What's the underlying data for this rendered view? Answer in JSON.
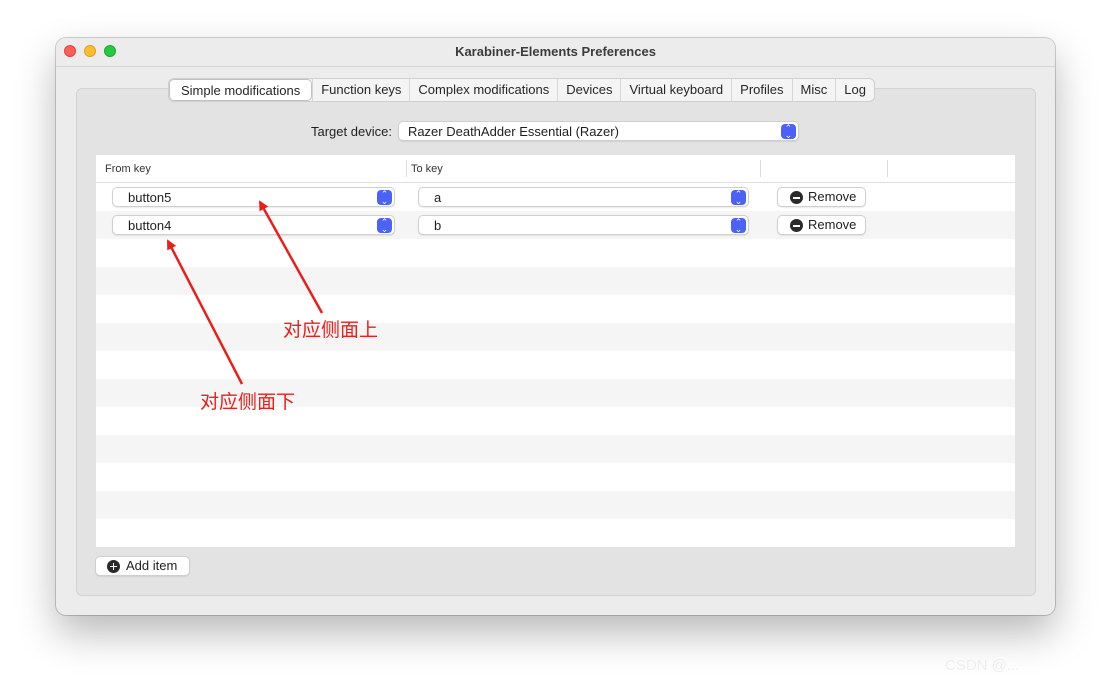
{
  "window": {
    "title": "Karabiner-Elements Preferences"
  },
  "tabs": [
    {
      "label": "Simple modifications",
      "active": true
    },
    {
      "label": "Function keys"
    },
    {
      "label": "Complex modifications"
    },
    {
      "label": "Devices"
    },
    {
      "label": "Virtual keyboard"
    },
    {
      "label": "Profiles"
    },
    {
      "label": "Misc"
    },
    {
      "label": "Log"
    }
  ],
  "target": {
    "label": "Target device:",
    "value": "Razer DeathAdder Essential (Razer)"
  },
  "table": {
    "headers": {
      "from": "From key",
      "to": "To key"
    },
    "rows": [
      {
        "from": "button5",
        "to": "a",
        "remove": "Remove"
      },
      {
        "from": "button4",
        "to": "b",
        "remove": "Remove"
      }
    ]
  },
  "add_item": "Add item",
  "annotations": {
    "upper": "对应侧面上",
    "lower": "对应侧面下"
  },
  "watermark": "CSDN @...",
  "colors": {
    "accent": "#4a63f6",
    "annotation": "#e8201c"
  },
  "icons": {
    "stepper": "up-down-chevron-icon",
    "remove": "minus-circle-icon",
    "add": "plus-circle-icon"
  }
}
